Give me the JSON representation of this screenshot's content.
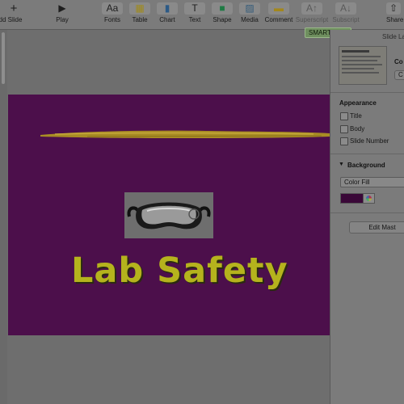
{
  "toolbar": {
    "buttons": [
      {
        "label": "dd Slide",
        "icon": "add-slide-icon",
        "glyph": "+"
      },
      {
        "label": "Play",
        "icon": "play-icon",
        "glyph": "▶"
      },
      {
        "label": "Fonts",
        "icon": "fonts-icon",
        "glyph": "Aa"
      },
      {
        "label": "Table",
        "icon": "table-icon",
        "glyph": "▦"
      },
      {
        "label": "Chart",
        "icon": "chart-icon",
        "glyph": "▮"
      },
      {
        "label": "Text",
        "icon": "text-icon",
        "glyph": "T"
      },
      {
        "label": "Shape",
        "icon": "shape-icon",
        "glyph": "■"
      },
      {
        "label": "Media",
        "icon": "media-icon",
        "glyph": "▨"
      },
      {
        "label": "Comment",
        "icon": "comment-icon",
        "glyph": "▬"
      },
      {
        "label": "Superscript",
        "icon": "superscript-icon",
        "glyph": "A↑"
      },
      {
        "label": "Subscript",
        "icon": "subscript-icon",
        "glyph": "A↓"
      },
      {
        "label": "Share",
        "icon": "share-icon",
        "glyph": "⇧"
      }
    ]
  },
  "smart_ink": {
    "label": "SMART Ink"
  },
  "slide": {
    "title": "Lab Safety",
    "background": "#4c0f4b",
    "stroke_color": "#b39a2a",
    "title_color": "#b5b31d"
  },
  "inspector": {
    "tab_label": "Slide La",
    "layout_label": "Co",
    "appearance_header": "Appearance",
    "checkboxes": [
      "Title",
      "Body",
      "Slide Number"
    ],
    "background_header": "Background",
    "fill_type": "Color Fill",
    "fill_color": "#3a0838",
    "edit_button": "Edit Mast"
  }
}
